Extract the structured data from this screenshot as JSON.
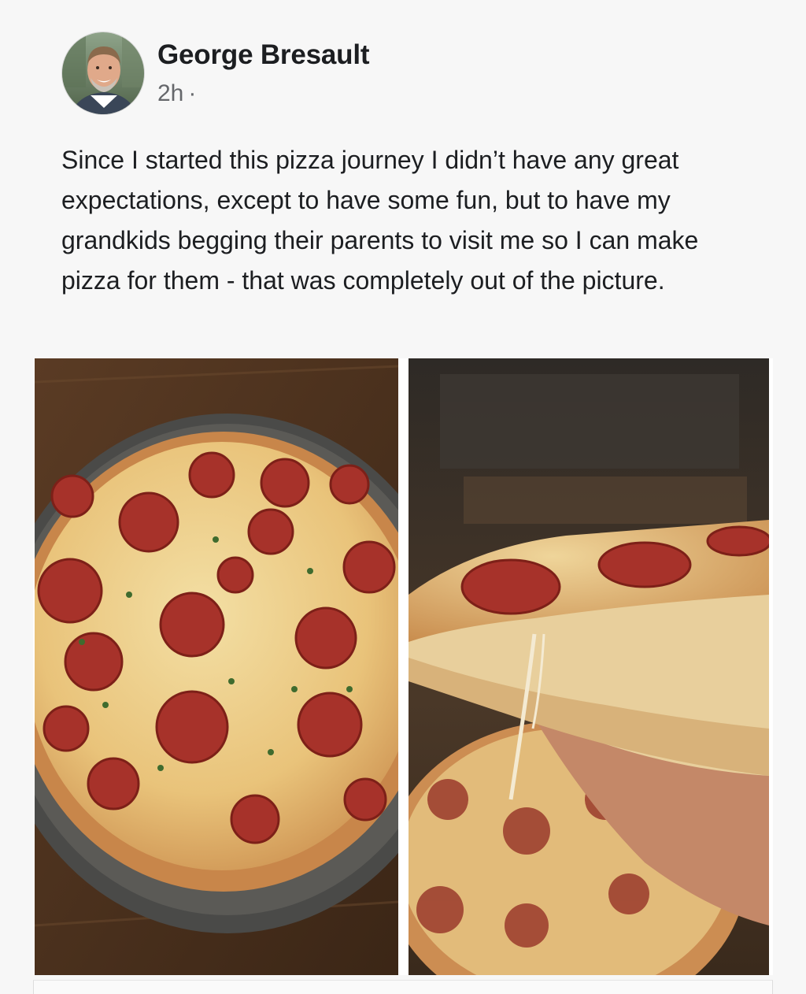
{
  "post": {
    "author": {
      "name": "George Bresault"
    },
    "time": "2h",
    "audience_separator": "·",
    "text": "Since I started this pizza journey I didn’t have any great expectations, except to have some fun, but to have my grandkids begging their parents to visit me so I can make pizza for them - that was completely out of the picture.",
    "photos": [
      {
        "name": "whole-pepperoni-pizza-photo"
      },
      {
        "name": "pizza-slice-cheese-pull-photo"
      }
    ]
  },
  "colors": {
    "text": "#1c1e21",
    "meta": "#65676b",
    "background": "#f7f7f7"
  }
}
